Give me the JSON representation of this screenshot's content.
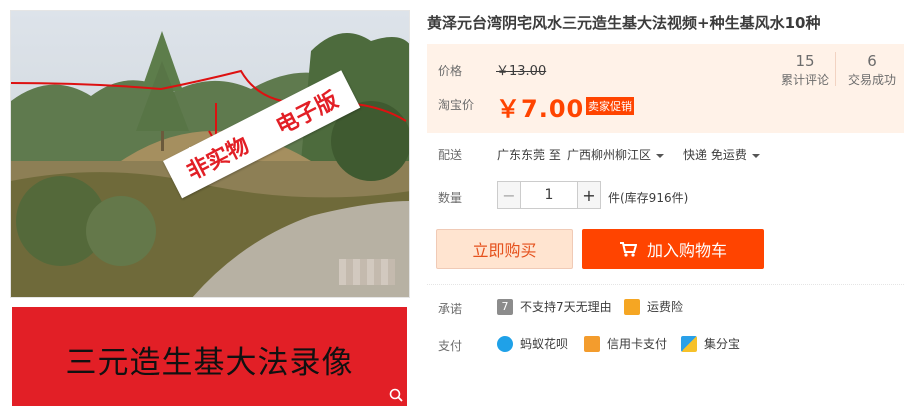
{
  "product": {
    "title": "黄泽元台湾阴宅风水三元造生基大法视频+种生基风水10种"
  },
  "gallery": {
    "stamp_left": "非实物",
    "stamp_right": "电子版",
    "banner_text": "三元造生基大法录像"
  },
  "price": {
    "label": "价格",
    "original": "￥13.00",
    "promo_label": "淘宝价",
    "promo": "￥7.00",
    "promo_tag": "卖家促销"
  },
  "stats": {
    "reviews_count": "15",
    "reviews_label": "累计评论",
    "deals_count": "6",
    "deals_label": "交易成功"
  },
  "delivery": {
    "label": "配送",
    "from": "广东东莞 至",
    "to": "广西柳州柳江区",
    "method": "快递 免运费"
  },
  "quantity": {
    "label": "数量",
    "value": "1",
    "minus": "−",
    "plus": "+",
    "stock": "件(库存916件)"
  },
  "actions": {
    "buy_now": "立即购买",
    "add_to_cart": "加入购物车"
  },
  "promise": {
    "label": "承诺",
    "no_return": "不支持7天无理由",
    "shipping_insurance": "运费险"
  },
  "payment": {
    "label": "支付",
    "huabei": "蚂蚁花呗",
    "credit_card": "信用卡支付",
    "jifenbao": "集分宝"
  },
  "colors": {
    "accent": "#ff4400",
    "price": "#ff4400",
    "price_bg": "#fff2e8",
    "banner": "#e21f26"
  }
}
